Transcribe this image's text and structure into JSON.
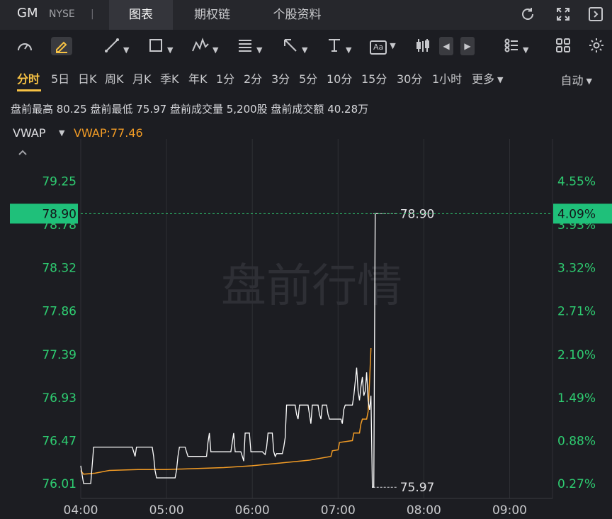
{
  "header": {
    "symbol": "GM",
    "exchange": "NYSE",
    "separator": "|",
    "tabs": [
      "图表",
      "期权链",
      "个股资料"
    ],
    "active_tab": "图表"
  },
  "toolbar": {
    "icons": [
      "gauge-icon",
      "pencil-icon",
      "line-tool-icon",
      "rectangle-tool-icon",
      "pattern-tool-icon",
      "fib-tool-icon",
      "arrow-tool-icon",
      "measure-tool-icon",
      "text-tool-icon",
      "candle-type-icon",
      "prev-icon",
      "next-icon",
      "indicator-list-icon",
      "layout-grid-icon",
      "settings-icon"
    ],
    "text_tool_label": "Aa"
  },
  "periods": {
    "items": [
      "分时",
      "5日",
      "日K",
      "周K",
      "月K",
      "季K",
      "年K",
      "1分",
      "2分",
      "3分",
      "5分",
      "10分",
      "15分",
      "30分",
      "1小时",
      "更多"
    ],
    "active": "分时",
    "auto_label": "自动"
  },
  "premarket": {
    "text": "盘前最高 80.25  盘前最低 75.97  盘前成交量 5,200股  盘前成交额 40.28万"
  },
  "indicator": {
    "name": "VWAP",
    "value_label": "VWAP:77.46"
  },
  "colors": {
    "price_line": "#ffffff",
    "vwap_line": "#f39c25",
    "up_green": "#2ecc71",
    "badge_green": "#1fc07a",
    "grid": "#34353a",
    "background": "#1c1d22"
  },
  "chart_data": {
    "type": "line",
    "watermark": "盘前行情",
    "current_price": "78.90",
    "current_pct": "4.09%",
    "annotations": [
      {
        "label": "78.90",
        "y": 78.9
      },
      {
        "label": "75.97",
        "y": 75.97
      }
    ],
    "y_ticks_price": [
      "79.25",
      "78.78",
      "78.32",
      "77.86",
      "77.39",
      "76.93",
      "76.47",
      "76.01"
    ],
    "y_ticks_pct": [
      "4.55%",
      "3.93%",
      "3.32%",
      "2.71%",
      "2.10%",
      "1.49%",
      "0.88%",
      "0.27%"
    ],
    "x_ticks": [
      "04:00",
      "05:00",
      "06:00",
      "07:00",
      "08:00",
      "09:00"
    ],
    "ylim": [
      75.85,
      79.7
    ],
    "xlim_minutes": [
      0,
      330
    ],
    "series": [
      {
        "type": "price",
        "x": [
          0,
          1,
          2,
          3,
          7,
          8,
          9,
          36,
          37,
          38,
          39,
          50,
          51,
          52,
          53,
          66,
          67,
          68,
          69,
          73,
          74,
          75,
          88,
          89,
          90,
          91,
          105,
          106,
          107,
          108,
          112,
          113,
          114,
          115,
          118,
          119,
          120,
          127,
          129,
          130,
          131,
          134,
          135,
          136,
          137,
          141,
          142,
          143,
          144,
          150,
          151,
          152,
          153,
          159,
          160,
          161,
          162,
          166,
          167,
          168,
          169,
          172,
          173,
          174,
          175,
          182,
          183,
          184,
          185,
          190,
          191,
          192,
          193,
          194,
          195,
          196,
          197,
          198,
          199,
          200,
          201,
          202,
          203,
          204,
          205,
          206,
          207,
          208
        ],
        "y": [
          76.2,
          76.1,
          76.01,
          76.01,
          76.01,
          76.2,
          76.4,
          76.4,
          76.35,
          76.3,
          76.4,
          76.4,
          76.3,
          76.15,
          76.07,
          76.07,
          76.15,
          76.3,
          76.4,
          76.4,
          76.35,
          76.3,
          76.3,
          76.45,
          76.55,
          76.35,
          76.35,
          76.45,
          76.55,
          76.35,
          76.35,
          76.3,
          76.25,
          76.55,
          76.55,
          76.35,
          76.35,
          76.35,
          76.32,
          76.4,
          76.55,
          76.55,
          76.35,
          76.3,
          76.33,
          76.33,
          76.4,
          76.5,
          76.85,
          76.85,
          76.75,
          76.7,
          76.85,
          76.85,
          76.75,
          76.65,
          76.85,
          76.85,
          76.75,
          76.7,
          76.85,
          76.85,
          76.75,
          76.7,
          76.7,
          76.7,
          76.65,
          76.8,
          76.85,
          76.85,
          76.95,
          77.1,
          77.25,
          77.0,
          76.9,
          77.05,
          77.15,
          76.95,
          77.0,
          77.2,
          76.9,
          76.8,
          76.95,
          75.97,
          75.97,
          78.9,
          78.9,
          78.9
        ],
        "points": 88
      },
      {
        "type": "vwap",
        "x": [
          0,
          2,
          10,
          20,
          40,
          60,
          80,
          100,
          120,
          140,
          160,
          175,
          176,
          180,
          181,
          190,
          191,
          195,
          196,
          197,
          200,
          201,
          202,
          203
        ],
        "y": [
          76.15,
          76.11,
          76.12,
          76.15,
          76.16,
          76.16,
          76.17,
          76.18,
          76.2,
          76.23,
          76.26,
          76.3,
          76.36,
          76.37,
          76.45,
          76.47,
          76.55,
          76.55,
          76.65,
          76.7,
          76.7,
          76.78,
          77.1,
          77.46
        ],
        "points": 24
      }
    ]
  }
}
